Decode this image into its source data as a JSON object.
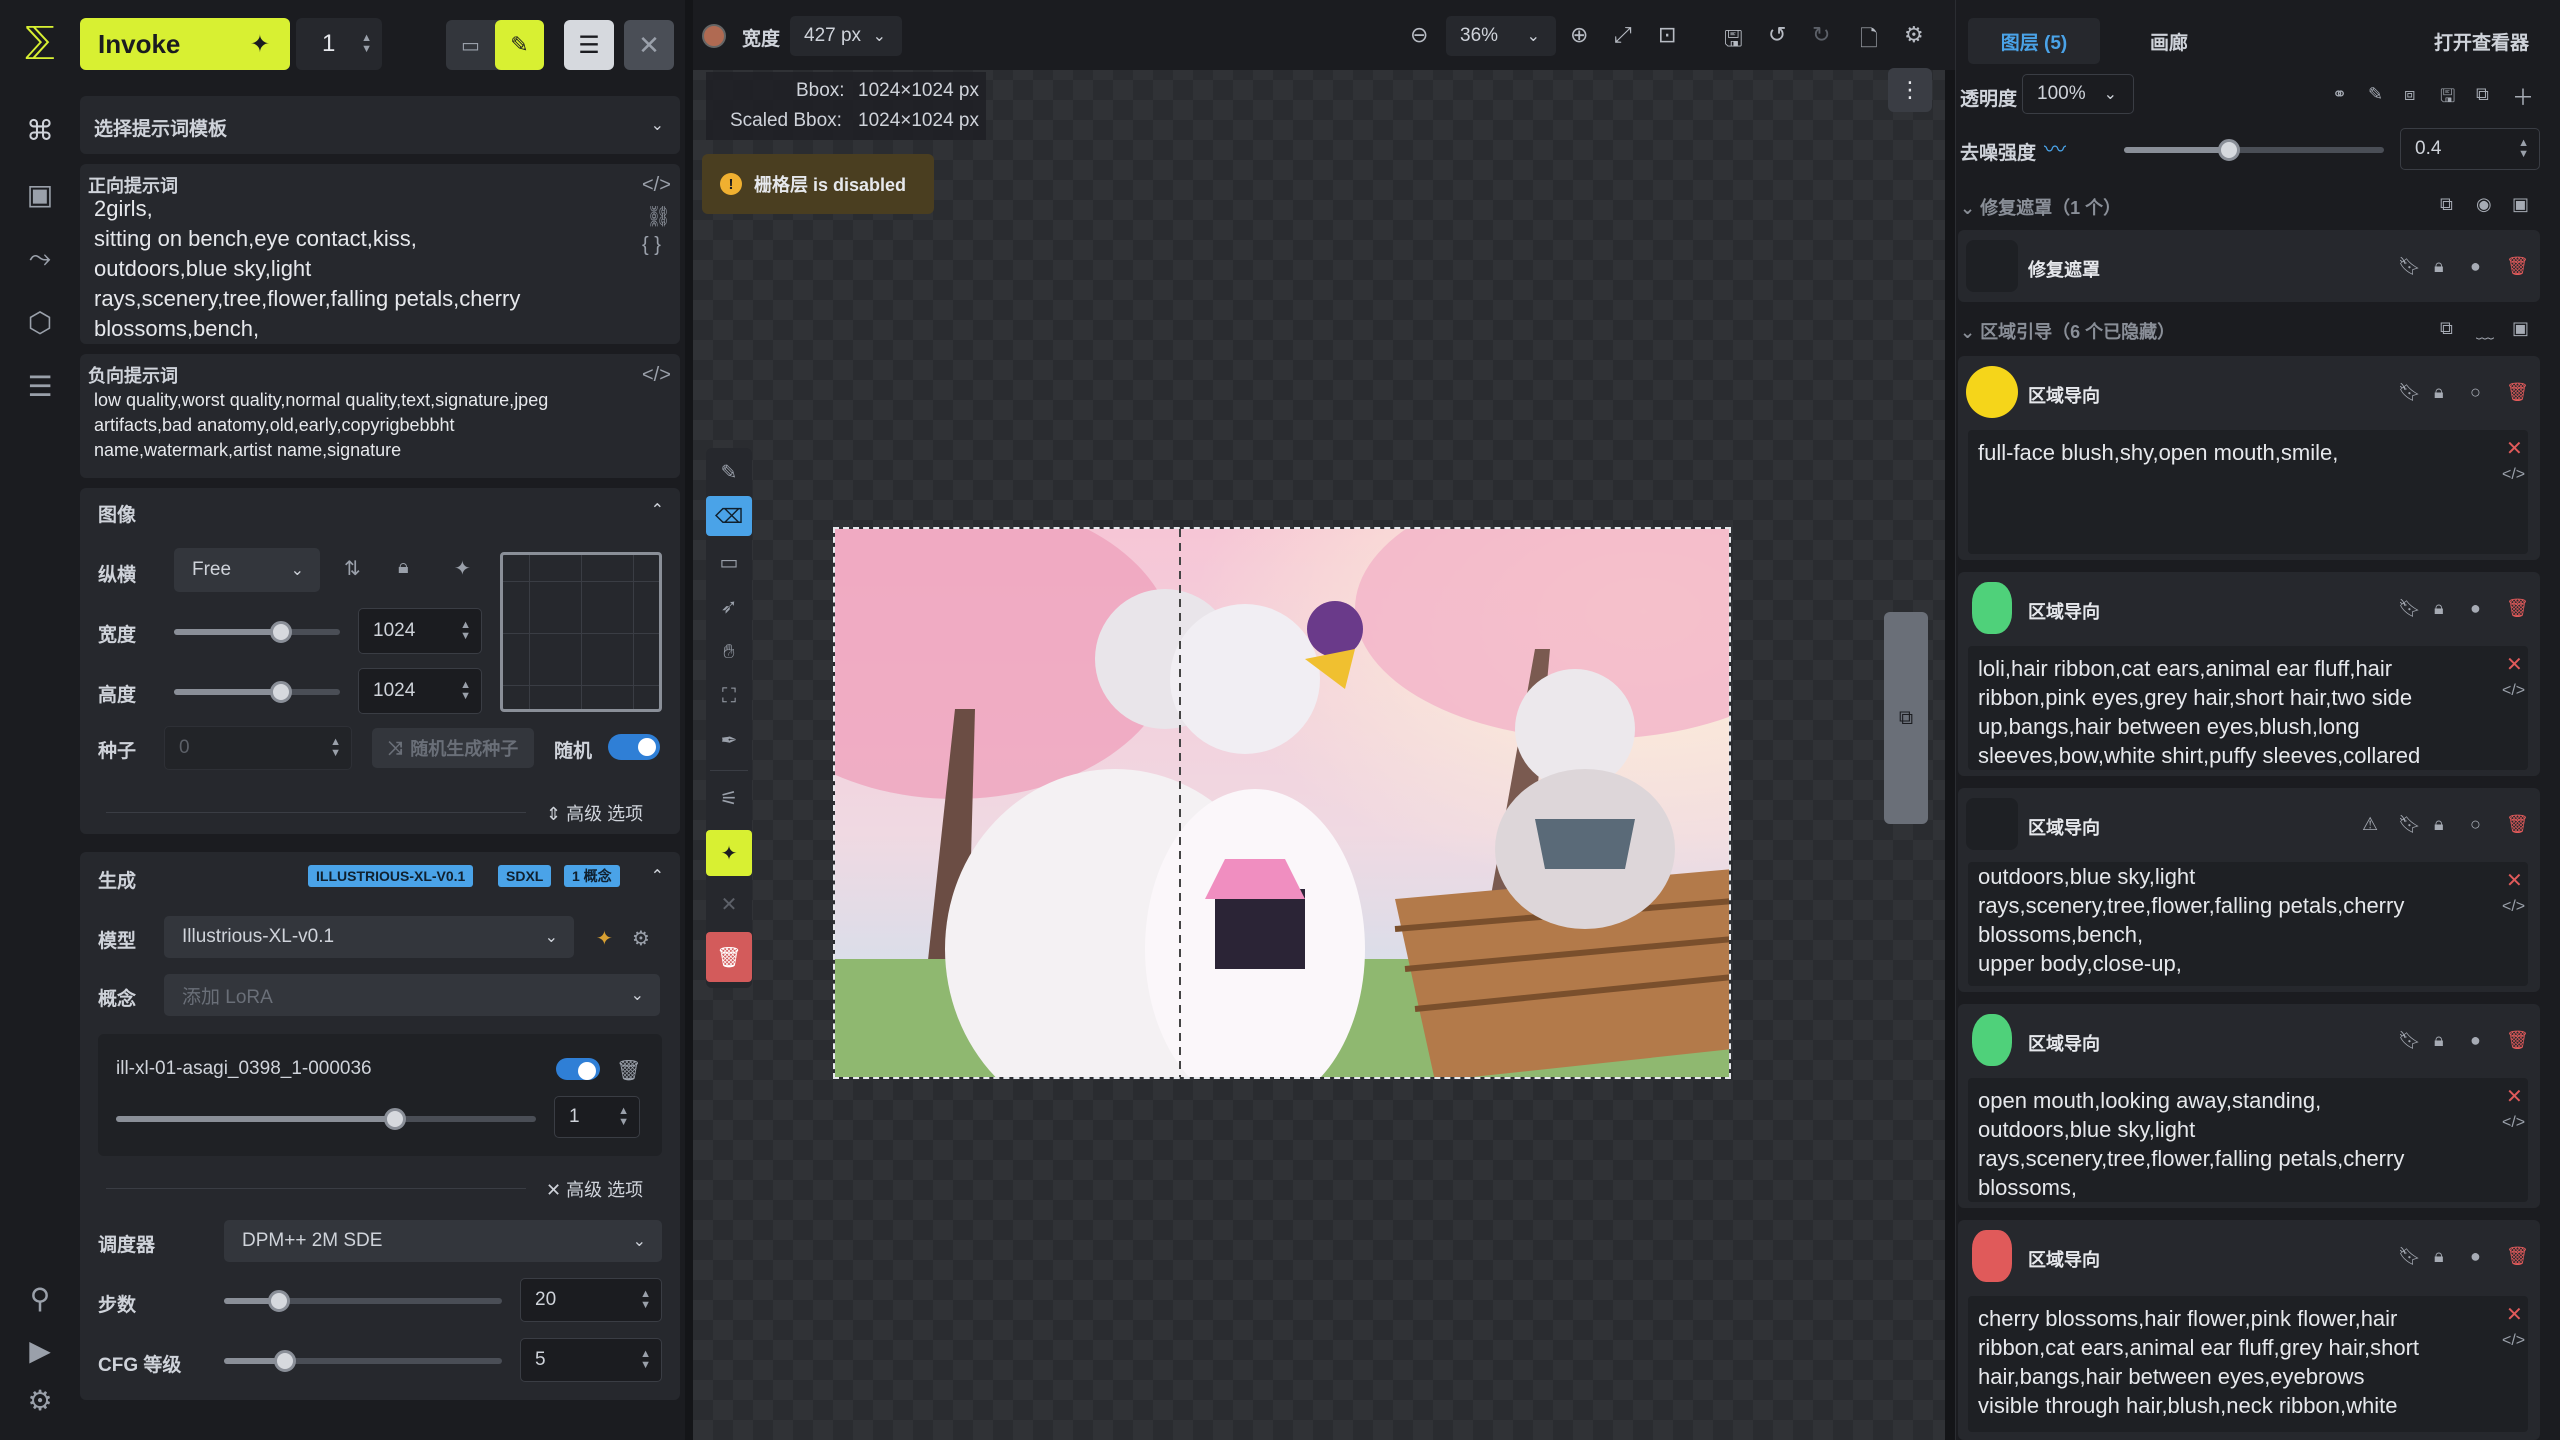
{
  "app": {
    "logo": "invoke-logo",
    "invoke_label": "Invoke",
    "queue_count": "1"
  },
  "left_nav": {
    "icons": [
      "canvas-icon",
      "image-icon",
      "workflow-icon",
      "model-icon",
      "queue-icon",
      "lightbulb-icon",
      "video-icon",
      "settings-icon"
    ]
  },
  "left_panel": {
    "prompt_template": "选择提示词模板",
    "positive_label": "正向提示词",
    "positive_text": "2girls,\nsitting on bench,eye contact,kiss,\noutdoors,blue sky,light\nrays,scenery,tree,flower,falling petals,cherry\nblossoms,bench,",
    "negative_label": "负向提示词",
    "negative_text": "low quality,worst quality,normal quality,text,signature,jpeg\nartifacts,bad anatomy,old,early,copyrigbebbht\nname,watermark,artist name,signature",
    "image_section": "图像",
    "aspect_label": "纵横",
    "aspect_value": "Free",
    "width_label": "宽度",
    "width_value": "1024",
    "height_label": "高度",
    "height_value": "1024",
    "seed_label": "种子",
    "seed_value": "0",
    "random_seed_btn": "随机生成种子",
    "random_label": "随机",
    "advanced1": "高级 选项",
    "gen_section": "生成",
    "tags": [
      "ILLUSTRIOUS-XL-V0.1",
      "SDXL",
      "1 概念"
    ],
    "model_label": "模型",
    "model_value": "Illustrious-XL-v0.1",
    "concept_label": "概念",
    "concept_placeholder": "添加 LoRA",
    "lora_name": "ill-xl-01-asagi_0398_1-000036",
    "lora_weight": "1",
    "advanced2": "高级 选项",
    "scheduler_label": "调度器",
    "scheduler_value": "DPM++ 2M SDE",
    "steps_label": "步数",
    "steps_value": "20",
    "cfg_label": "CFG 等级",
    "cfg_value": "5"
  },
  "toolbar": {
    "width_label": "宽度",
    "width_value": "427 px",
    "zoom_value": "36%"
  },
  "canvas": {
    "bbox_label": "Bbox:",
    "bbox_value": "1024×1024 px",
    "scaled_label": "Scaled Bbox:",
    "scaled_value": "1024×1024 px",
    "warning": "栅格层 is disabled"
  },
  "right_panel": {
    "tab_layers": "图层 (5)",
    "tab_canvas": "画廊",
    "open_viewer": "打开查看器",
    "opacity_label": "透明度",
    "opacity_value": "100%",
    "denoise_label": "去噪强度",
    "denoise_value": "0.4",
    "inpaint_group": "修复遮罩（1 个）",
    "inpaint_item": "修复遮罩",
    "region_group": "区域引导（6 个已隐藏）",
    "regions": [
      {
        "title": "区域导向",
        "color": "#f5d51a",
        "text": "full-face blush,shy,open mouth,smile,"
      },
      {
        "title": "区域导向",
        "color": "#4fd17a",
        "text": "loli,hair ribbon,cat ears,animal ear fluff,hair\nribbon,pink eyes,grey hair,short hair,two side\nup,bangs,hair between eyes,blush,long\nsleeves,bow,white shirt,puffy sleeves,collared"
      },
      {
        "title": "区域导向",
        "color": "#1e2024",
        "text": "outdoors,blue sky,light\nrays,scenery,tree,flower,falling petals,cherry\nblossoms,bench,\nupper body,close-up,"
      },
      {
        "title": "区域导向",
        "color": "#4fd17a",
        "text": "open mouth,looking away,standing,\noutdoors,blue sky,light\nrays,scenery,tree,flower,falling petals,cherry\nblossoms,"
      },
      {
        "title": "区域导向",
        "color": "#e05a5a",
        "text": "cherry blossoms,hair flower,pink flower,hair\nribbon,cat ears,animal ear fluff,grey hair,short\nhair,bangs,hair between eyes,eyebrows\nvisible through hair,blush,neck ribbon,white"
      }
    ]
  }
}
